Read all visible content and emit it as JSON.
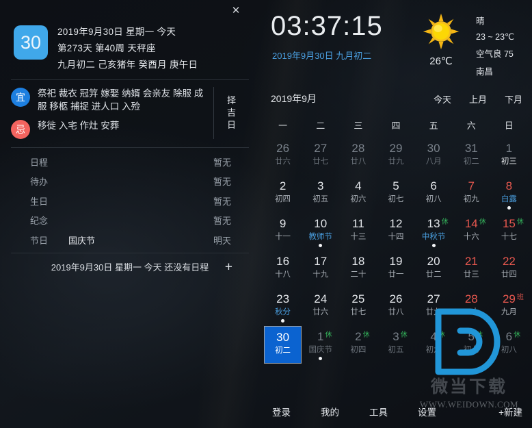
{
  "window": {
    "close_icon": "close-icon",
    "close_glyph": "✕"
  },
  "left": {
    "badge_day": "30",
    "date_lines": [
      "2019年9月30日 星期一 今天",
      "第273天 第40周 天秤座",
      "九月初二 己亥猪年 癸酉月 庚午日"
    ],
    "yi": {
      "label": "宜",
      "text": "祭祀 裁衣 冠笄 嫁娶 纳婿 会亲友 除服 成服 移柩 捕捉 进人口 入殓",
      "color": "#1d7fe0"
    },
    "ji": {
      "label": "忌",
      "text": "移徙 入宅 作灶 安葬",
      "color": "#f4645f"
    },
    "zeji": "择吉日",
    "info_rows": [
      {
        "label": "日程",
        "value": "",
        "status": "暂无"
      },
      {
        "label": "待办",
        "value": "",
        "status": "暂无"
      },
      {
        "label": "生日",
        "value": "",
        "status": "暂无"
      },
      {
        "label": "纪念",
        "value": "",
        "status": "暂无"
      },
      {
        "label": "节日",
        "value": "国庆节",
        "status": "明天"
      }
    ],
    "schedule_bar": "2019年9月30日 星期一 今天 还没有日程",
    "add_glyph": "+"
  },
  "right": {
    "clock": {
      "time": "03:37:15",
      "sub": "2019年9月30日 九月初二"
    },
    "weather": {
      "icon": "sun-icon",
      "temp": "26℃",
      "condition": "晴",
      "range": "23 ~ 23℃",
      "air": "空气良 75",
      "city": "南昌"
    },
    "calendar": {
      "title": "2019年9月",
      "nav": [
        "今天",
        "上月",
        "下月"
      ],
      "weekdays": [
        "一",
        "二",
        "三",
        "四",
        "五",
        "六",
        "日"
      ],
      "cells": [
        {
          "num": "26",
          "lun": "廿六",
          "out": true
        },
        {
          "num": "27",
          "lun": "廿七",
          "out": true
        },
        {
          "num": "28",
          "lun": "廿八",
          "out": true
        },
        {
          "num": "29",
          "lun": "廿九",
          "out": true
        },
        {
          "num": "30",
          "lun": "八月",
          "out": true
        },
        {
          "num": "31",
          "lun": "初二",
          "out": true
        },
        {
          "num": "1",
          "lun": "初三",
          "out": true,
          "weekend": true,
          "lun_style": "white"
        },
        {
          "num": "2",
          "lun": "初四"
        },
        {
          "num": "3",
          "lun": "初五"
        },
        {
          "num": "4",
          "lun": "初六"
        },
        {
          "num": "5",
          "lun": "初七"
        },
        {
          "num": "6",
          "lun": "初八"
        },
        {
          "num": "7",
          "lun": "初九",
          "weekend": true
        },
        {
          "num": "8",
          "lun": "白露",
          "weekend": true,
          "lun_style": "accent",
          "dot": true
        },
        {
          "num": "9",
          "lun": "十一"
        },
        {
          "num": "10",
          "lun": "教师节",
          "lun_style": "accent",
          "dot": true
        },
        {
          "num": "11",
          "lun": "十三"
        },
        {
          "num": "12",
          "lun": "十四"
        },
        {
          "num": "13",
          "lun": "中秋节",
          "lun_style": "accent",
          "tag": "休",
          "tag_type": "xiu",
          "dot": true
        },
        {
          "num": "14",
          "lun": "十六",
          "weekend": true,
          "tag": "休",
          "tag_type": "xiu"
        },
        {
          "num": "15",
          "lun": "十七",
          "weekend": true,
          "tag": "休",
          "tag_type": "xiu"
        },
        {
          "num": "16",
          "lun": "十八"
        },
        {
          "num": "17",
          "lun": "十九"
        },
        {
          "num": "18",
          "lun": "二十"
        },
        {
          "num": "19",
          "lun": "廿一"
        },
        {
          "num": "20",
          "lun": "廿二"
        },
        {
          "num": "21",
          "lun": "廿三",
          "weekend": true
        },
        {
          "num": "22",
          "lun": "廿四",
          "weekend": true
        },
        {
          "num": "23",
          "lun": "秋分",
          "lun_style": "accent",
          "dot": true
        },
        {
          "num": "24",
          "lun": "廿六"
        },
        {
          "num": "25",
          "lun": "廿七"
        },
        {
          "num": "26",
          "lun": "廿八"
        },
        {
          "num": "27",
          "lun": "廿九"
        },
        {
          "num": "28",
          "lun": "三十",
          "weekend": true
        },
        {
          "num": "29",
          "lun": "九月",
          "weekend": true,
          "tag": "班",
          "tag_type": "ban"
        },
        {
          "num": "30",
          "lun": "初二",
          "selected": true
        },
        {
          "num": "1",
          "lun": "国庆节",
          "out": true,
          "tag": "休",
          "tag_type": "xiu",
          "dot": true
        },
        {
          "num": "2",
          "lun": "初四",
          "out": true,
          "tag": "休",
          "tag_type": "xiu"
        },
        {
          "num": "3",
          "lun": "初五",
          "out": true,
          "tag": "休",
          "tag_type": "xiu"
        },
        {
          "num": "4",
          "lun": "初六",
          "out": true,
          "tag": "休",
          "tag_type": "xiu"
        },
        {
          "num": "5",
          "lun": "初七",
          "out": true,
          "tag": "休",
          "tag_type": "xiu"
        },
        {
          "num": "6",
          "lun": "初八",
          "out": true,
          "tag": "休",
          "tag_type": "xiu"
        }
      ]
    },
    "footer": [
      "登录",
      "我的",
      "工具",
      "设置"
    ],
    "footer_new": "+新建"
  },
  "watermark": {
    "logo": "D",
    "cn": "微当下载",
    "url": "WWW.WEIDOWN.COM",
    "color": "#2196d8"
  },
  "colors": {
    "accent": "#40a8ea",
    "red": "#e8584f",
    "green": "#35b55c",
    "selected": "#0b63d0"
  }
}
